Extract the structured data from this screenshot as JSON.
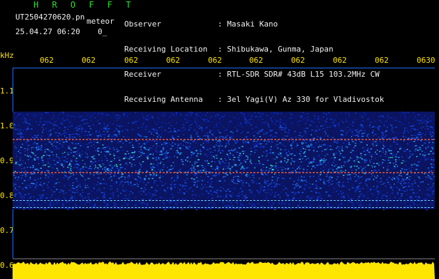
{
  "header": {
    "brand": "H R O F F T",
    "file_name": "UT2504270620.pn",
    "meteor_tag": "meteor",
    "datetime": "25.04.27 06:20",
    "flag": "0_",
    "labels": [
      "Observer",
      "Receiving Location",
      "Receiver",
      "Receiving Antenna"
    ],
    "values": [
      ": Masaki Kano",
      ": Shibukawa, Gunma, Japan",
      ": RTL-SDR SDR# 43dB L15 103.2MHz CW",
      ": 3el Yagi(V) Az 330 for Vladivostok"
    ]
  },
  "y_axis": {
    "unit": "kHz",
    "ticks": [
      "1.1",
      "1.0",
      "0.9",
      "0.8",
      "0.7",
      "0.6"
    ]
  },
  "x_axis": {
    "ticks": [
      "062",
      "062",
      "062",
      "062",
      "062",
      "062",
      "062",
      "062",
      "062",
      "0630"
    ]
  },
  "colors": {
    "header_label": "#f2f2f2",
    "brand": "#28e428",
    "axis_text": "#ffe600",
    "frame": "#1e6fff",
    "echo_level": "#ffe600"
  },
  "spectrogram": {
    "band_khz": [
      0.76,
      1.04
    ],
    "carrier_lines_khz": [
      0.96,
      0.865,
      0.785,
      0.765
    ]
  }
}
